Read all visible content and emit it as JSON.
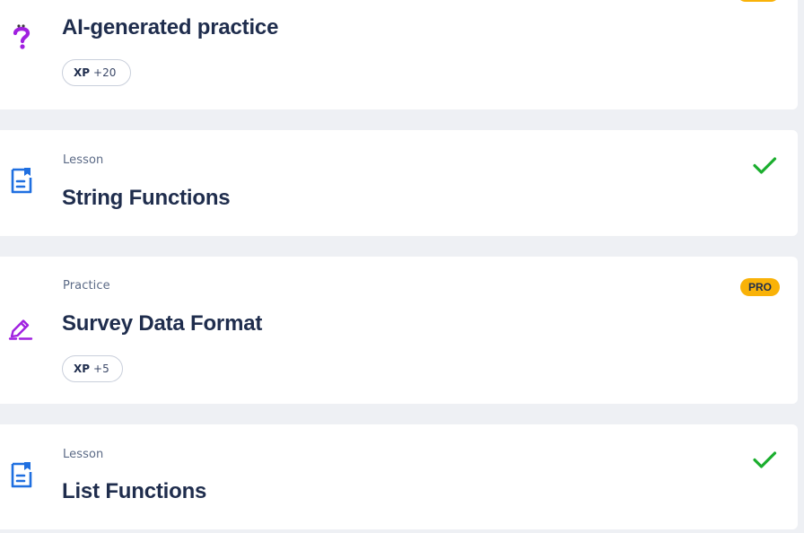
{
  "items": [
    {
      "type": "",
      "title": "AI-generated practice",
      "icon": "question-mark-icon",
      "xp_label": "XP",
      "xp_value": "+20",
      "status": "pro-partial"
    },
    {
      "type": "Lesson",
      "title": "String Functions",
      "icon": "lesson-document-icon",
      "status": "completed"
    },
    {
      "type": "Practice",
      "title": "Survey Data Format",
      "icon": "pencil-edit-icon",
      "xp_label": "XP",
      "xp_value": "+5",
      "badge": "PRO"
    },
    {
      "type": "Lesson",
      "title": "List Functions",
      "icon": "lesson-document-icon",
      "status": "completed"
    }
  ],
  "colors": {
    "background": "#eef0f4",
    "card": "#ffffff",
    "title": "#1f2d4d",
    "label": "#5b6a86",
    "check": "#1bae2e",
    "pro_badge": "#f9b208",
    "question_icon": "#a020e0",
    "lesson_icon": "#1f6fe0",
    "practice_icon": "#a020e0"
  }
}
